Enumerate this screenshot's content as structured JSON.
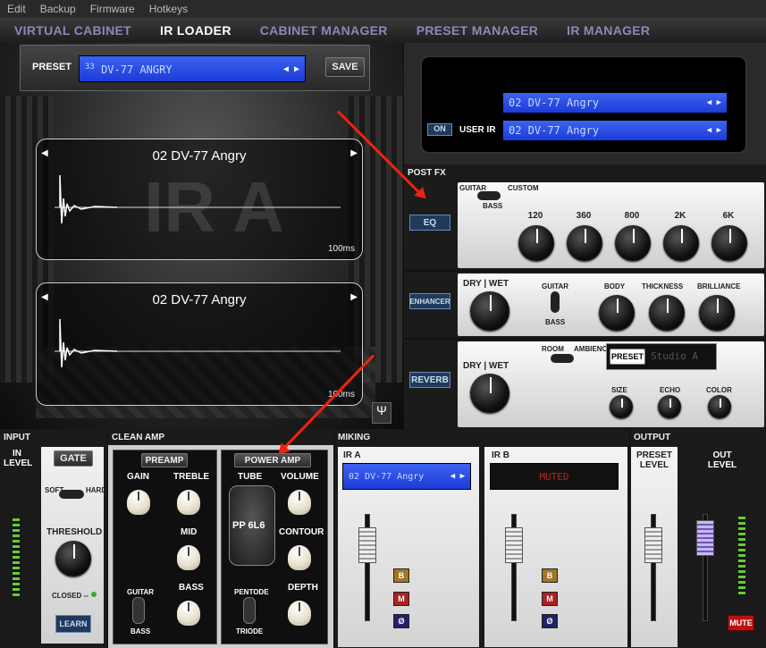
{
  "menu": [
    "Edit",
    "Backup",
    "Firmware",
    "Hotkeys"
  ],
  "nav_tabs": [
    {
      "label": "VIRTUAL CABINET",
      "active": false
    },
    {
      "label": "IR LOADER",
      "active": true
    },
    {
      "label": "CABINET MANAGER",
      "active": false
    },
    {
      "label": "PRESET MANAGER",
      "active": false
    },
    {
      "label": "IR MANAGER",
      "active": false
    }
  ],
  "preset": {
    "label": "PRESET",
    "number": "33",
    "name": "DV-77 ANGRY",
    "save": "SAVE"
  },
  "ir_a": {
    "title": "02 DV-77 Angry",
    "time": "100ms",
    "watermark": "IR A"
  },
  "ir_b": {
    "title": "02 DV-77 Angry",
    "time": "100ms"
  },
  "user_ir": {
    "row1": "02 DV-77 Angry",
    "row2": "02 DV-77 Angry",
    "on_label": "ON",
    "label": "USER IR"
  },
  "post_fx": {
    "label": "POST FX",
    "eq": {
      "button": "EQ",
      "switch_left": "GUITAR",
      "switch_right": "CUSTOM",
      "switch_bottom": "BASS",
      "bands": [
        "120",
        "360",
        "800",
        "2K",
        "6K"
      ]
    },
    "enhancer": {
      "button": "ENHANCER",
      "dry_wet": "DRY | WET",
      "switch_top": "GUITAR",
      "switch_bottom": "BASS",
      "knobs": [
        "BODY",
        "THICKNESS",
        "BRILLIANCE"
      ]
    },
    "reverb": {
      "button": "REVERB",
      "dry_wet": "DRY | WET",
      "switch_left": "ROOM",
      "switch_right": "AMBIENCE",
      "preset_label": "PRESET",
      "preset_value": "Studio A",
      "knobs": [
        "SIZE",
        "ECHO",
        "COLOR"
      ]
    }
  },
  "input": {
    "head": "INPUT",
    "level": "IN\nLEVEL",
    "gate": "GATE",
    "soft": "SOFT",
    "hard": "HARD",
    "threshold": "THRESHOLD",
    "closed": "CLOSED --",
    "learn": "LEARN"
  },
  "clean_amp": {
    "head": "CLEAN AMP",
    "preamp": "PREAMP",
    "power_amp": "POWER AMP",
    "gain": "GAIN",
    "treble": "TREBLE",
    "mid": "MID",
    "bass": "BASS",
    "guitar": "GUITAR",
    "bass_sw": "BASS",
    "tube": "TUBE",
    "tube_name": "PP 6L6",
    "volume": "VOLUME",
    "contour": "CONTOUR",
    "depth": "DEPTH",
    "pentode": "PENTODE",
    "triode": "TRIODE"
  },
  "miking": {
    "head": "MIKING",
    "ir_a_label": "IR A",
    "ir_a_value": "02 DV-77 Angry",
    "ir_b_label": "IR B",
    "ir_b_value": "MUTED",
    "b": "B",
    "m": "M",
    "phase": "Ø"
  },
  "output": {
    "head": "OUTPUT",
    "preset_level": "PRESET\nLEVEL",
    "out_level": "OUT\nLEVEL",
    "mute": "MUTE"
  },
  "colors": {
    "lcd_blue": "#2b4ce6",
    "nav_purple": "#8e87b8",
    "arrow_red": "#e21b1b"
  }
}
